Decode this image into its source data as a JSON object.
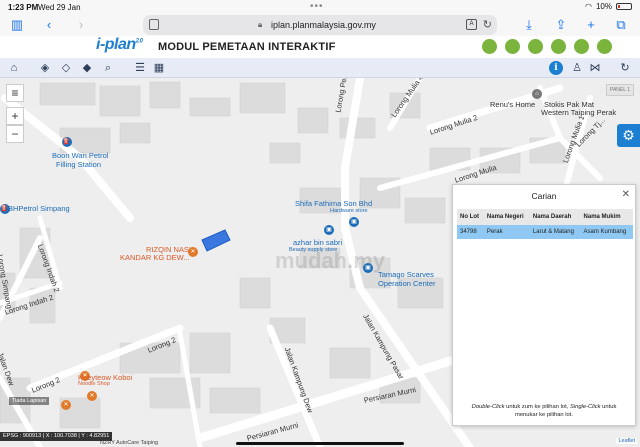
{
  "status_bar": {
    "time": "1:23 PM",
    "date": "Wed 29 Jan",
    "battery": "10%"
  },
  "browser": {
    "url": "iplan.planmalaysia.gov.my"
  },
  "site": {
    "logo": "i-plan",
    "logo_sup": "2.0",
    "title": "MODUL PEMETAAN INTERAKTIF"
  },
  "map": {
    "panel_tag": "PANEL 1",
    "watermark": "mudah.my",
    "labels": {
      "boon_wan": "Boon Wan Petrol",
      "boon_wan2": "Filling Station",
      "bhpetrol": "BHPetrol Simpang",
      "shifa": "Shifa Fathima Son Bhd",
      "shifa_sub": "Hardware store",
      "rizqin": "RIZQIN NASI",
      "rizqin2": "KANDAR KG DEW...",
      "azhar": "azhar bin sabri",
      "azhar_sub": "Beauty supply store",
      "tamago": "Tamago Scarves",
      "tamago2": "Operation Center",
      "renu": "Renu's Home",
      "stokis": "Stokis Pak Mat",
      "stokis2": "Western Taiping Perak",
      "kueyteow": "Kueyteow Koboi",
      "kueyteow_sub": "Noodle Shop"
    },
    "roads": {
      "permai": "Lorong Permai",
      "mulia4": "Lorong Mulia 4",
      "mulia2": "Lorong Mulia 2",
      "mulia": "Lorong Mulia",
      "mulia1": "Lorong Mulia 1",
      "indah2a": "Lorong Indah 2",
      "indah2b": "Lorong Indah 2",
      "lorong2a": "Lorong 2",
      "lorong2b": "Lorong 2",
      "kampung": "Jalan Kampung Dew",
      "pasar": "Jalan Kampung Pasar",
      "murni": "Persiaran Murni",
      "murni2": "Persiaran Murni",
      "simpang": "Lorong Simpang",
      "dew": "Jalan Dew",
      "tj": "Lorong Tj..."
    },
    "tiada": "Tiada Lapisan",
    "footer": "EPSG : 900913 | X : 100.7038 | Y : 4.82951",
    "footer2": "NZRY AutoCare Taiping",
    "leaflet": "Leaflet"
  },
  "search_panel": {
    "title": "Carian",
    "columns": [
      "No Lot",
      "Nama Negeri",
      "Nama Daerah",
      "Nama Mukim"
    ],
    "rows": [
      {
        "lot": "34798",
        "negeri": "Perak",
        "daerah": "Larut & Matang",
        "mukim": "Asam Kumbang"
      }
    ],
    "note_em1": "Double-Click",
    "note_1": " untuk zum ke pilihan lot, ",
    "note_em2": "Single-Click",
    "note_2": " untuk menukar ke pilihan lot."
  }
}
